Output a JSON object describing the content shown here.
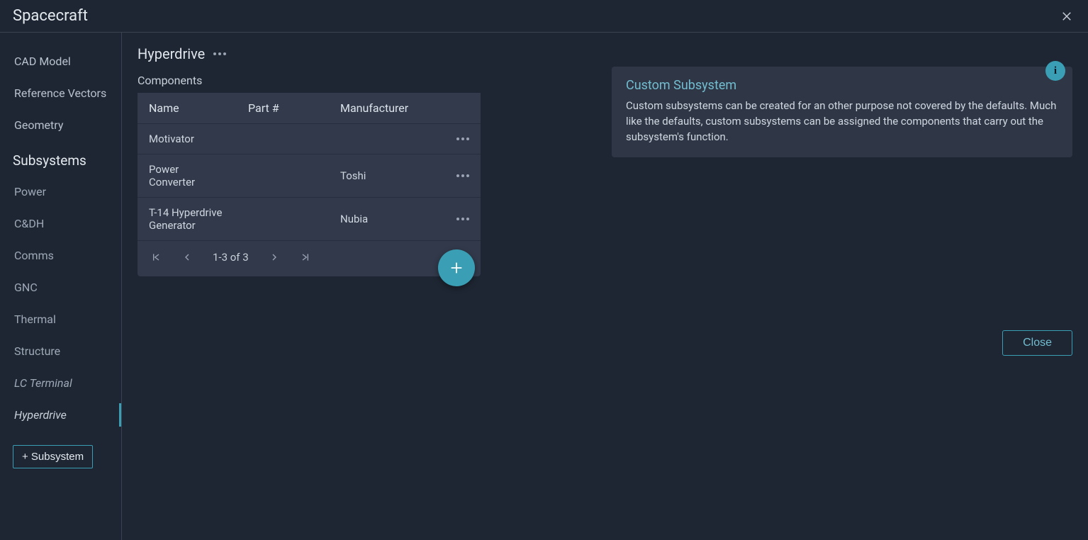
{
  "header": {
    "title": "Spacecraft"
  },
  "sidebar": {
    "top_items": [
      "CAD Model",
      "Reference Vectors",
      "Geometry"
    ],
    "heading": "Subsystems",
    "subsystem_items": [
      "Power",
      "C&DH",
      "Comms",
      "GNC",
      "Thermal",
      "Structure",
      "LC Terminal",
      "Hyperdrive"
    ],
    "active_index": 7,
    "italic_indices": [
      6,
      7
    ],
    "add_button": "+ Subsystem"
  },
  "main": {
    "title": "Hyperdrive",
    "components_label": "Components",
    "columns": [
      "Name",
      "Part #",
      "Manufacturer"
    ],
    "rows": [
      {
        "name": "Motivator",
        "part": "",
        "manufacturer": ""
      },
      {
        "name": "Power Converter",
        "part": "",
        "manufacturer": "Toshi"
      },
      {
        "name": "T-14 Hyperdrive Generator",
        "part": "",
        "manufacturer": "Nubia"
      }
    ],
    "pagination": "1-3 of 3"
  },
  "info": {
    "title": "Custom Subsystem",
    "body": "Custom subsystems can be created for an other purpose not covered by the defaults. Much like the defaults, custom subsystems can be assigned the components that carry out the subsystem's function.",
    "badge": "i"
  },
  "close_button": "Close"
}
